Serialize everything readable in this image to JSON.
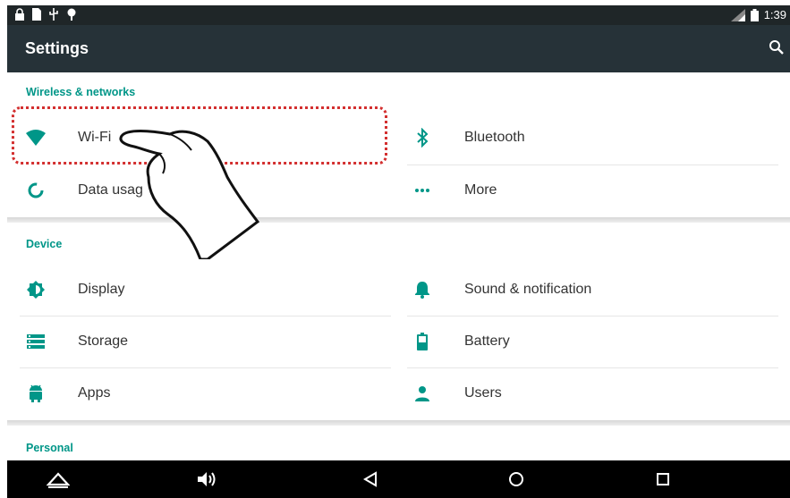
{
  "status_bar": {
    "time": "1:39"
  },
  "app_bar": {
    "title": "Settings"
  },
  "sections": {
    "wireless": {
      "header": "Wireless & networks"
    },
    "device": {
      "header": "Device"
    },
    "personal": {
      "header": "Personal"
    }
  },
  "items": {
    "wifi": "Wi-Fi",
    "bluetooth": "Bluetooth",
    "data_usage": "Data usag",
    "more": "More",
    "display": "Display",
    "sound": "Sound & notification",
    "storage": "Storage",
    "battery": "Battery",
    "apps": "Apps",
    "users": "Users"
  },
  "colors": {
    "accent": "#009688",
    "app_bar": "#263238",
    "highlight": "#d32f2f"
  }
}
